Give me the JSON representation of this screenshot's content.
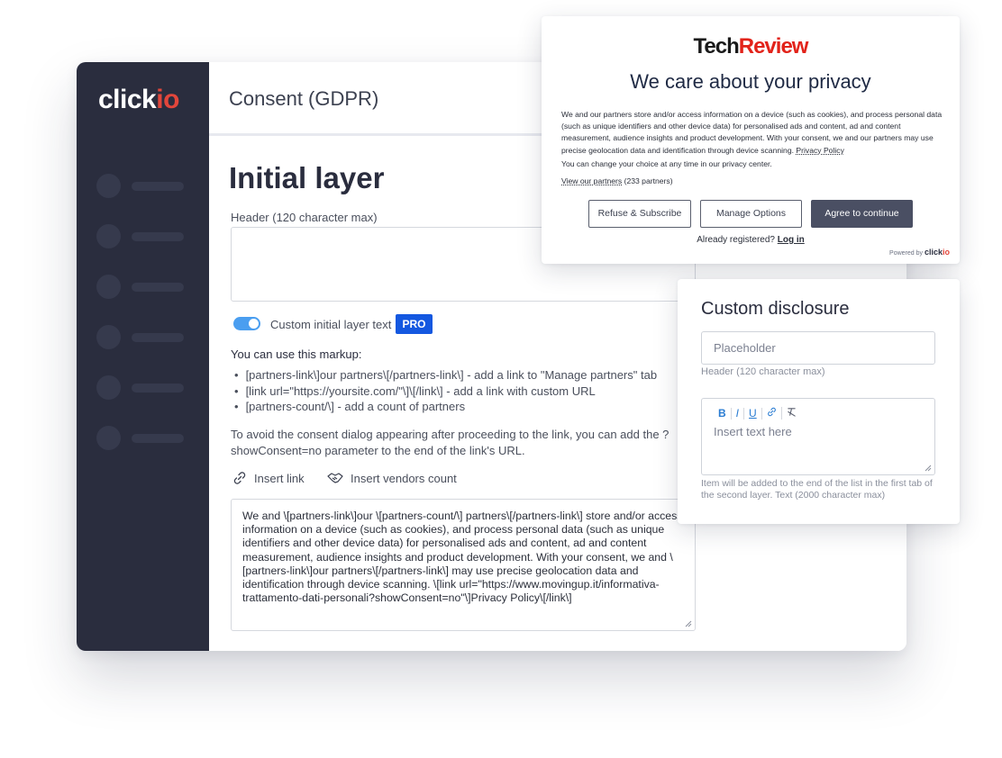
{
  "app": {
    "logo_main": "click",
    "logo_accent": "io",
    "page_header": "Consent (GDPR)"
  },
  "sidebar": {
    "items": [
      {
        "icon": "nav-placeholder-icon"
      },
      {
        "icon": "nav-placeholder-icon"
      },
      {
        "icon": "nav-placeholder-icon"
      },
      {
        "icon": "nav-placeholder-icon"
      },
      {
        "icon": "nav-placeholder-icon"
      },
      {
        "icon": "nav-placeholder-icon"
      }
    ]
  },
  "initial_layer": {
    "title": "Initial layer",
    "header_label": "Header (120 character max)",
    "header_value": "",
    "toggle_label": "Custom initial layer text",
    "toggle_on": true,
    "pro_badge": "PRO",
    "markup_title": "You can use this markup:",
    "markup_items": [
      "[partners-link\\]our partners\\[/partners-link\\] - add a link to \"Manage partners\" tab",
      "[link url=\"https://yoursite.com/\"\\]\\[/link\\] - add a link with custom URL",
      "[partners-count/\\] - add a count of partners"
    ],
    "note": "To avoid the consent dialog appearing after proceeding to the link, you can add the ?showConsent=no parameter to the end of the link's URL.",
    "insert_link": "Insert link",
    "insert_vendors": "Insert vendors count",
    "body_text": "We and \\[partners-link\\]our \\[partners-count/\\] partners\\[/partners-link\\] store and/or access information on a device (such as cookies), and process personal data (such as unique identifiers and other device data) for personalised ads and content, ad and content measurement, audience insights and product development. With your consent, we and \\[partners-link\\]our partners\\[/partners-link\\] may use precise geolocation data and identification through device scanning. \\[link url=\"https://www.movingup.it/informativa-trattamento-dati-personali?showConsent=no\"\\]Privacy Policy\\[/link\\]"
  },
  "popup": {
    "brand_part1": "Tech",
    "brand_part2": "Review",
    "title": "We care about your privacy",
    "body": "We and our partners store and/or access information on a device (such as cookies), and process personal data (such as unique identifiers and other device data) for personalised ads and content, ad and content measurement, audience insights and product development. With your consent, we and our partners may use precise geolocation data and identification through device scanning.",
    "privacy_link": "Privacy Policy",
    "change_choice": "You can change your choice at any time in our privacy center.",
    "partners_link": "View our partners",
    "partners_count": "(233 partners)",
    "btn_refuse": "Refuse & Subscribe",
    "btn_manage": "Manage Options",
    "btn_agree": "Agree to continue",
    "already_registered": "Already registered?",
    "login": "Log in",
    "powered_by": "Powered by",
    "powered_brand": "click",
    "powered_brand_accent": "io"
  },
  "disclosure": {
    "title": "Custom disclosure",
    "header_placeholder": "Placeholder",
    "header_hint": "Header (120 character max)",
    "toolbar": [
      "B",
      "I",
      "U",
      "link",
      "clear"
    ],
    "text_placeholder": "Insert text here",
    "text_hint": "Item will be added to the end of the list in the first tab of the second layer. Text (2000 character max)"
  },
  "colors": {
    "sidebar": "#2a2d3e",
    "accent_red": "#e2463b",
    "pro_blue": "#1458e0",
    "toggle_blue": "#4a9ef0",
    "agree_button": "#4a4f63"
  }
}
